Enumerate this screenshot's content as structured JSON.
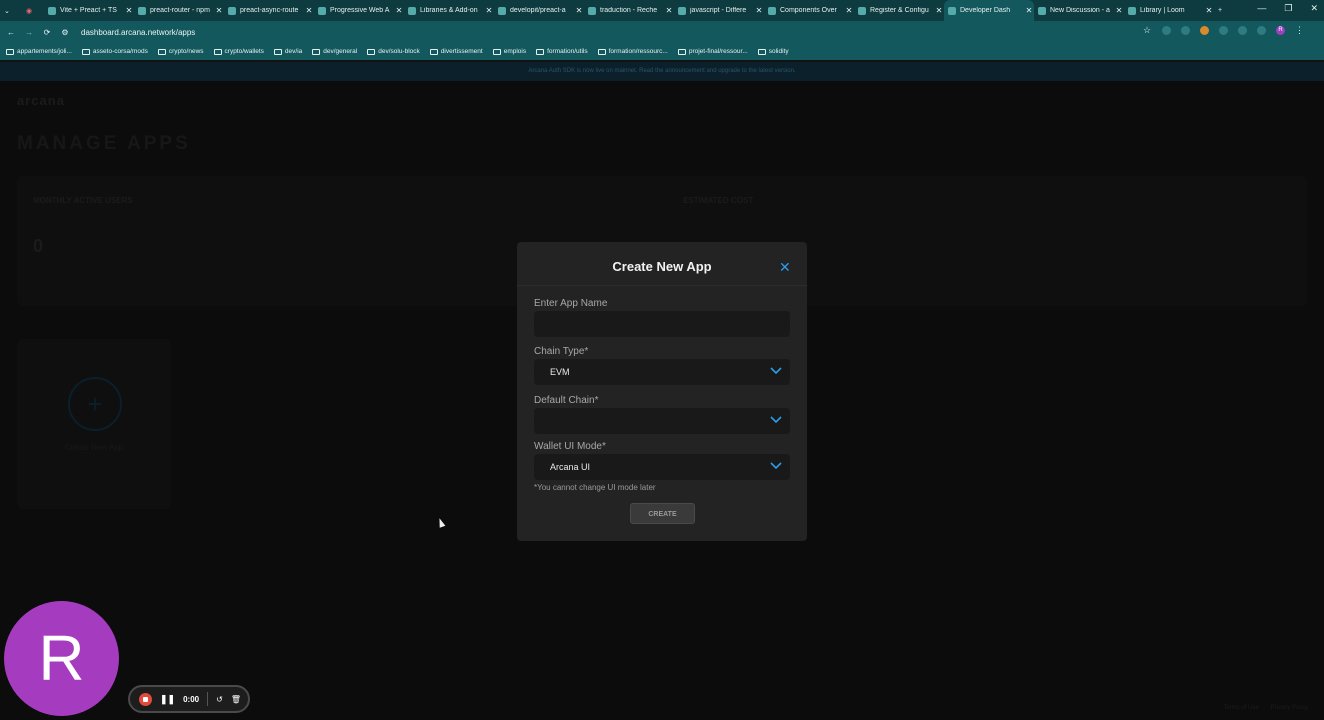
{
  "browser": {
    "tabs": [
      {
        "label": "Vite + Preact + TS",
        "active": false
      },
      {
        "label": "preact-router - npm",
        "active": false
      },
      {
        "label": "preact-async-route",
        "active": false
      },
      {
        "label": "Progressive Web A",
        "active": false
      },
      {
        "label": "Libraries & Add-on",
        "active": false
      },
      {
        "label": "developit/preact-a",
        "active": false
      },
      {
        "label": "traduction - Reche",
        "active": false
      },
      {
        "label": "javascript - Differe",
        "active": false
      },
      {
        "label": "Components Over",
        "active": false
      },
      {
        "label": "Register & Configu",
        "active": false
      },
      {
        "label": "Developer Dash",
        "active": true
      },
      {
        "label": "New Discussion - a",
        "active": false
      },
      {
        "label": "Library | Loom",
        "active": false
      }
    ],
    "new_tab": "+",
    "url": "dashboard.arcana.network/apps",
    "profile_initial": "R",
    "bookmarks": [
      "appartements/joli...",
      "asseto-corsa/mods",
      "crypto/news",
      "crypto/wallets",
      "dev/ia",
      "dev/general",
      "dev/solu-block",
      "divertissement",
      "emplois",
      "formation/utils",
      "formation/ressourc...",
      "projet-final/ressour...",
      "solidity"
    ]
  },
  "banner": {
    "text": "Arcana Auth SDK is now live on mainnet. Read the announcement and upgrade to the latest version."
  },
  "page": {
    "logo": "arcana",
    "title": "MANAGE APPS",
    "monthly_users_label": "MONTHLY ACTIVE USERS",
    "monthly_users_value": "0",
    "estimated_cost_label": "ESTIMATED COST",
    "create_new_app_label": "Create New App",
    "footer_terms": "Terms of Use",
    "footer_privacy": "Privacy Policy"
  },
  "modal": {
    "title": "Create New App",
    "app_name_label": "Enter App Name",
    "app_name_value": "",
    "chain_type_label": "Chain Type*",
    "chain_type_value": "EVM",
    "default_chain_label": "Default Chain*",
    "default_chain_value": "",
    "wallet_ui_label": "Wallet UI Mode*",
    "wallet_ui_value": "Arcana UI",
    "note": "*You cannot change UI mode later",
    "create_label": "CREATE",
    "accent_color": "#2b9de6"
  },
  "recorder": {
    "avatar_initial": "R",
    "time": "0:00"
  }
}
